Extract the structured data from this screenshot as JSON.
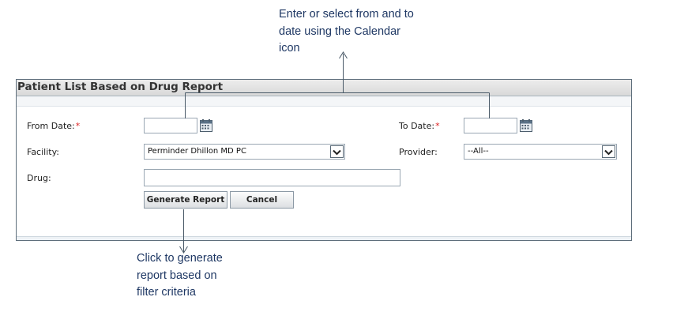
{
  "annotations": {
    "top": [
      "Enter or select from and to",
      "date using the Calendar",
      "icon"
    ],
    "bottom": [
      "Click to generate",
      "report based on",
      "filter criteria"
    ]
  },
  "panel": {
    "title": "Patient List Based on Drug Report"
  },
  "form": {
    "from_date_label": "From Date:",
    "to_date_label": "To Date:",
    "required_mark": "*",
    "from_date_value": "",
    "to_date_value": "",
    "facility_label": "Facility:",
    "facility_value": "Perminder Dhillon MD PC",
    "provider_label": "Provider:",
    "provider_value": "--All--",
    "drug_label": "Drug:",
    "drug_value": ""
  },
  "buttons": {
    "generate": "Generate Report",
    "cancel": "Cancel"
  },
  "icons": {
    "calendar": "calendar-icon",
    "dropdown": "chevron-down-icon"
  },
  "colors": {
    "annotation_text": "#1f3864",
    "required": "#d22222",
    "panel_border": "#5f6f7c"
  }
}
